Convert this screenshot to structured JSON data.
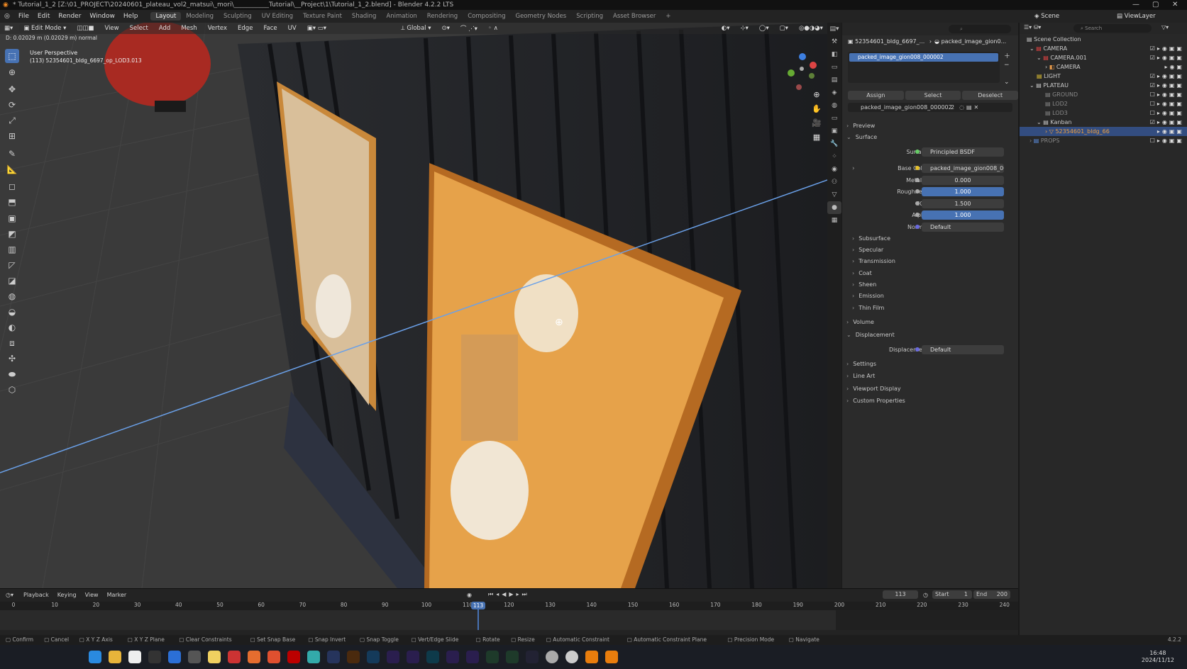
{
  "window": {
    "title": "* Tutorial_1_2 [Z:\\01_PROJECT\\20240601_plateau_vol2_matsui\\_mori\\___________Tutorial\\__Project\\1\\Tutorial_1_2.blend] - Blender 4.2.2 LTS"
  },
  "menubar": {
    "menus": [
      "File",
      "Edit",
      "Render",
      "Window",
      "Help"
    ],
    "workspaces": [
      "Layout",
      "Modeling",
      "Sculpting",
      "UV Editing",
      "Texture Paint",
      "Shading",
      "Animation",
      "Rendering",
      "Compositing",
      "Geometry Nodes",
      "Scripting",
      "Asset Browser"
    ],
    "active_workspace": "Layout",
    "scene_label": "Scene",
    "viewlayer_label": "ViewLayer"
  },
  "viewport": {
    "mode": "Edit Mode",
    "menus": [
      "View",
      "Select",
      "Add",
      "Mesh",
      "Vertex",
      "Edge",
      "Face",
      "UV"
    ],
    "transform_orientation": "Global",
    "status_text": "D: 0.02029 m (0.02029 m) normal",
    "perspective_label": "User Perspective",
    "object_label": "(113) 52354601_bldg_6697_op_LOD3.013"
  },
  "properties": {
    "breadcrumb": [
      "52354601_bldg_6697_...",
      "packed_image_gion0..."
    ],
    "material_slot": "packed_image_gion008_000002",
    "buttons": {
      "assign": "Assign",
      "select": "Select",
      "deselect": "Deselect"
    },
    "material_name": "packed_image_gion008_000002",
    "material_users": "2",
    "sections_top": {
      "preview": "Preview",
      "surface": "Surface"
    },
    "surface": {
      "surface_label": "Surface",
      "surface_value": "Principled BSDF",
      "base_color_label": "Base Color",
      "base_color_value": "packed_image_gion008_0000...",
      "metallic_label": "Metallic",
      "metallic_value": "0.000",
      "roughness_label": "Roughness",
      "roughness_value": "1.000",
      "ior_label": "IOR",
      "ior_value": "1.500",
      "alpha_label": "Alpha",
      "alpha_value": "1.000",
      "normal_label": "Normal",
      "normal_value": "Default"
    },
    "subsections": [
      "Subsurface",
      "Specular",
      "Transmission",
      "Coat",
      "Sheen",
      "Emission",
      "Thin Film"
    ],
    "volume": "Volume",
    "displacement_header": "Displacement",
    "displacement_label": "Displacement",
    "displacement_value": "Default",
    "bottom_sections": [
      "Settings",
      "Line Art",
      "Viewport Display",
      "Custom Properties"
    ]
  },
  "outliner": {
    "search_placeholder": "Search",
    "rows": [
      {
        "name": "Scene Collection"
      },
      {
        "name": "CAMERA"
      },
      {
        "name": "CAMERA.001"
      },
      {
        "name": "CAMERA"
      },
      {
        "name": "LIGHT"
      },
      {
        "name": "PLATEAU"
      },
      {
        "name": "GROUND"
      },
      {
        "name": "LOD2"
      },
      {
        "name": "LOD3"
      },
      {
        "name": "Kanban"
      },
      {
        "name": "52354601_bldg_66"
      },
      {
        "name": "PROPS"
      }
    ]
  },
  "timeline": {
    "menus": [
      "Playback",
      "Keying",
      "View",
      "Marker"
    ],
    "current_frame": "113",
    "start_label": "Start",
    "start_value": "1",
    "end_label": "End",
    "end_value": "200",
    "ticks": [
      "0",
      "10",
      "20",
      "30",
      "40",
      "50",
      "60",
      "70",
      "80",
      "90",
      "100",
      "110",
      "120",
      "130",
      "140",
      "150",
      "160",
      "170",
      "180",
      "190",
      "200",
      "210",
      "220",
      "230",
      "240"
    ]
  },
  "statusbar": {
    "items": [
      "Confirm",
      "Cancel",
      "X Y Z Axis",
      "X Y Z Plane",
      "Clear Constraints",
      "Set Snap Base",
      "Snap Invert",
      "Snap Toggle",
      "Vert/Edge Slide",
      "Rotate",
      "Resize",
      "Automatic Constraint",
      "Automatic Constraint Plane",
      "Precision Mode",
      "Navigate"
    ],
    "version": "4.2.2"
  },
  "taskbar": {
    "time": "16:48",
    "date": "2024/11/12"
  },
  "colors": {
    "accent": "#4772b3",
    "selection_orange": "#f0a030"
  }
}
